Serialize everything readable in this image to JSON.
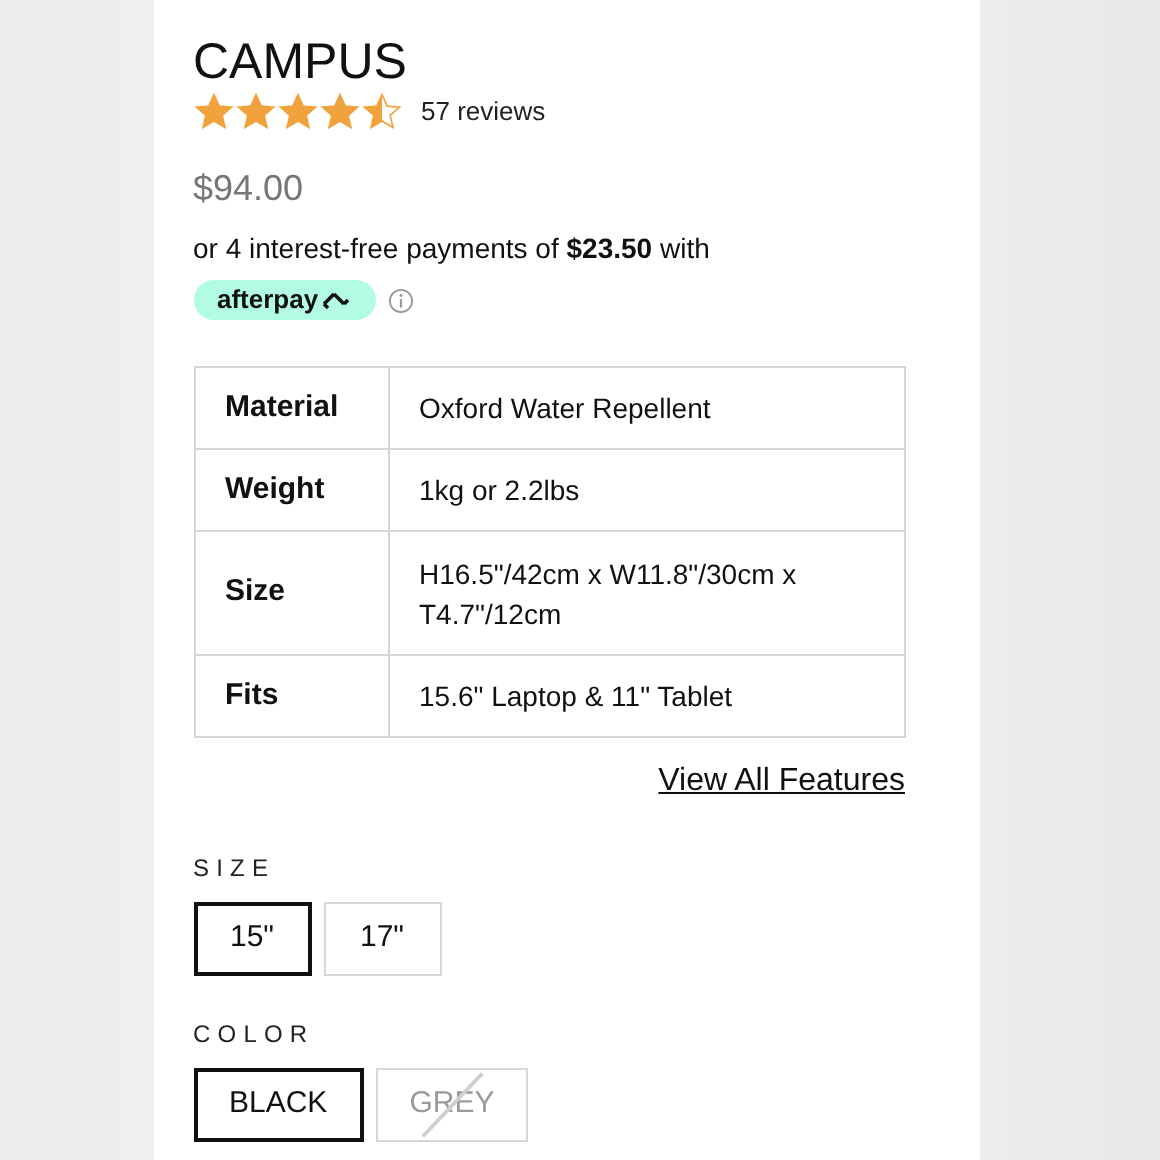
{
  "product": {
    "title": "CAMPUS",
    "stars": 4.5,
    "reviews": "57 reviews",
    "price": "$94.00",
    "installments": "or 4 interest-free payments of **$23.50** with",
    "afterpay": "afterpay"
  },
  "specs": [
    {
      "label": "Material",
      "value": "Oxford Water Repellent"
    },
    {
      "label": "Weight",
      "value": "1kg or 2.2lbs"
    },
    {
      "label": "Size",
      "value": "H16.5\"/42cm x W11.8\"/30cm x T4.7\"/12cm"
    },
    {
      "label": "Fits",
      "value": "15.6\" Laptop & 11\" Tablet"
    }
  ],
  "features_link": "View All Features",
  "size": {
    "label": "SIZE",
    "options": [
      {
        "label": "15\"",
        "selected": true,
        "disabled": false
      },
      {
        "label": "17\"",
        "selected": false,
        "disabled": false
      }
    ]
  },
  "color": {
    "label": "COLOR",
    "options": [
      {
        "label": "BLACK",
        "selected": true,
        "disabled": false
      },
      {
        "label": "GREY",
        "selected": false,
        "disabled": true
      }
    ]
  }
}
